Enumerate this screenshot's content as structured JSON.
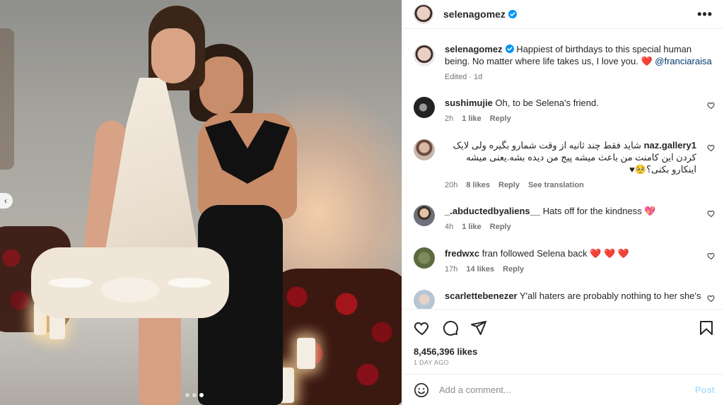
{
  "post": {
    "username": "selenagomez",
    "verified": true,
    "caption": {
      "username": "selenagomez",
      "text": "Happiest of birthdays to this special human being. No matter where life takes us, I love you.",
      "emoji": "❤️",
      "mention": "@franciaraisa",
      "edited": "Edited",
      "time": "1d"
    }
  },
  "comments": [
    {
      "username": "sushimujie",
      "text": "Oh, to be Selena's friend.",
      "time": "2h",
      "likes": "1 like",
      "reply": "Reply"
    },
    {
      "username": "naz.gallery1",
      "text": "شاید فقط چند ثانیه از وقت شمارو بگیره ولی لایک کردن این کامنت من باعث میشه پیج من دیده بشه.یعنی میشه اینکارو بکنی؟🥺♥",
      "time": "20h",
      "likes": "8 likes",
      "reply": "Reply",
      "translate": "See translation"
    },
    {
      "username": "_.abductedbyaliens__",
      "text": "Hats off for the kindness",
      "emoji": "💖",
      "time": "4h",
      "likes": "1 like",
      "reply": "Reply"
    },
    {
      "username": "fredwxc",
      "text": "fran followed Selena back",
      "emoji": "❤️ ❤️ ❤️",
      "time": "17h",
      "likes": "14 likes",
      "reply": "Reply"
    },
    {
      "username": "scarlettebenezer",
      "text": "Y'all haters are probably nothing to her she's",
      "time": "",
      "likes": "",
      "reply": ""
    }
  ],
  "actions": {
    "likes": "8,456,396 likes",
    "date": "1 DAY AGO"
  },
  "composer": {
    "placeholder": "Add a comment...",
    "post_label": "Post"
  },
  "icons": {
    "more": "more-options-icon",
    "like": "heart-icon",
    "comment": "comment-icon",
    "share": "share-icon",
    "save": "bookmark-icon",
    "emoji": "emoji-icon",
    "prev": "chevron-left-icon"
  },
  "colors": {
    "verified": "#0095f6",
    "link": "#00376b",
    "heart_red": "#ed4956",
    "post_disabled": "#b2dffc"
  },
  "carousel": {
    "total": 3,
    "active_index": 2,
    "prev_glyph": "‹"
  }
}
